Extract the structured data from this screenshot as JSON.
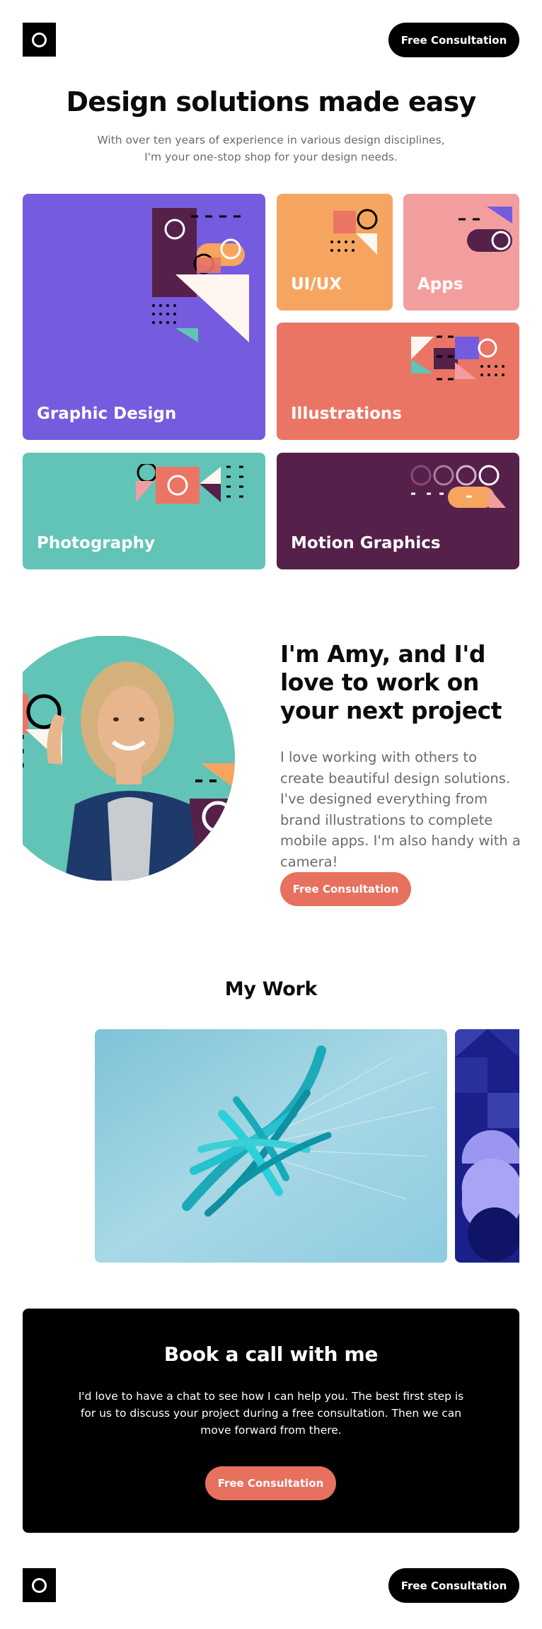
{
  "header": {
    "logo_icon": "circle-logo-icon",
    "cta_label": "Free Consultation"
  },
  "hero": {
    "title": "Design solutions made easy",
    "subtitle": "With over ten years of experience in various design disciplines, I'm your one-stop shop for your design needs."
  },
  "services": [
    {
      "label": "Graphic Design",
      "color": "#755cde"
    },
    {
      "label": "UI/UX",
      "color": "#f6a560"
    },
    {
      "label": "Apps",
      "color": "#f39e9e"
    },
    {
      "label": "Illustrations",
      "color": "#eb7565"
    },
    {
      "label": "Photography",
      "color": "#61c4b7"
    },
    {
      "label": "Motion Graphics",
      "color": "#552049"
    }
  ],
  "about": {
    "heading": "I'm Amy, and I'd love to work on your next project",
    "body": "I love working with others to create beautiful design solutions. I've designed everything from brand illustrations to complete mobile apps. I'm also handy with a camera!",
    "cta_label": "Free Consultation"
  },
  "work": {
    "heading": "My Work"
  },
  "cta_section": {
    "heading": "Book a call with me",
    "body": "I'd love to have a chat to see how I can help you. The best first step is for us to discuss your project during a free consultation. Then we can move forward from there.",
    "cta_label": "Free Consultation"
  },
  "footer": {
    "logo_icon": "circle-logo-icon",
    "cta_label": "Free Consultation"
  },
  "colors": {
    "coral": "#e8705f",
    "black": "#000000",
    "muted_text": "#6b6b6b"
  }
}
